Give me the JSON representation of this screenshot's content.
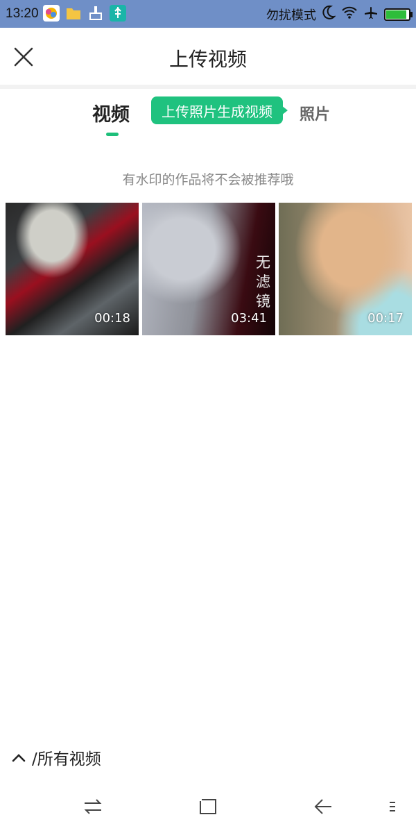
{
  "status_bar": {
    "time": "13:20",
    "dnd_label": "勿扰模式",
    "battery_level": 0.9,
    "icons": [
      "photos-app-icon",
      "folder-icon",
      "cleaner-icon",
      "usb-icon",
      "moon-icon",
      "wifi-icon",
      "airplane-icon",
      "battery-icon"
    ]
  },
  "header": {
    "title": "上传视频"
  },
  "tabs": {
    "video": "视频",
    "photo": "照片",
    "tooltip": "上传照片生成视频",
    "active": "video"
  },
  "notice": "有水印的作品将不会被推荐哦",
  "videos": [
    {
      "duration": "00:18"
    },
    {
      "duration": "03:41",
      "overlay_text": "无滤镜"
    },
    {
      "duration": "00:17"
    }
  ],
  "album_selector": {
    "label": "/所有视频"
  },
  "colors": {
    "accent": "#1fc27f",
    "status_bar": "#6f8fc7"
  }
}
